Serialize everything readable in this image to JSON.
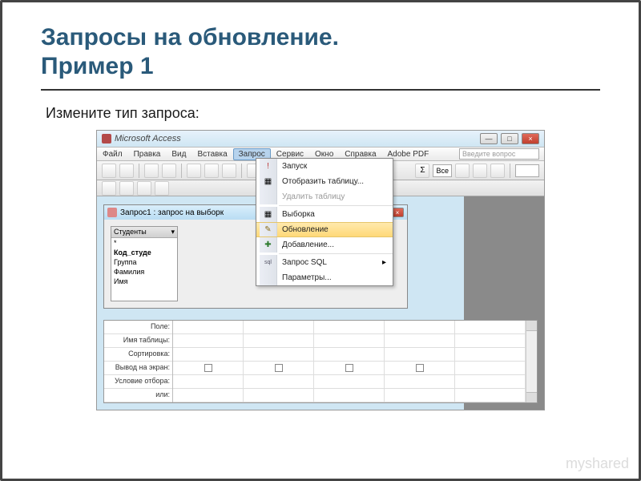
{
  "slide": {
    "title_line1": "Запросы на обновление.",
    "title_line2": "Пример 1",
    "subtitle": "Измените тип запроса:"
  },
  "watermark": "myshared",
  "app": {
    "title": "Microsoft Access",
    "win_min": "—",
    "win_max": "□",
    "win_close": "×"
  },
  "menubar": {
    "file": "Файл",
    "edit": "Правка",
    "view": "Вид",
    "insert": "Вставка",
    "query": "Запрос",
    "tools": "Сервис",
    "window": "Окно",
    "help": "Справка",
    "adobepdf": "Adobe PDF",
    "ask_placeholder": "Введите вопрос"
  },
  "toolbar": {
    "sum": "Σ",
    "all": "Все"
  },
  "mdi": {
    "title": "Запрос1 : запрос на выборк"
  },
  "fieldlist": {
    "header": "Студенты",
    "star": "*",
    "items": [
      "Код_студе",
      "Группа",
      "Фамилия",
      "Имя"
    ]
  },
  "dropdown": {
    "run": "Запуск",
    "show_table": "Отобразить таблицу...",
    "delete_table": "Удалить таблицу",
    "select": "Выборка",
    "update": "Обновление",
    "append": "Добавление...",
    "sql": "Запрос SQL",
    "params": "Параметры..."
  },
  "grid": {
    "row_field": "Поле:",
    "row_table": "Имя таблицы:",
    "row_sort": "Сортировка:",
    "row_show": "Вывод на экран:",
    "row_criteria": "Условие отбора:",
    "row_or": "или:"
  },
  "icons": {
    "run": "!",
    "sql": "sql",
    "pencil": "✎",
    "plus": "✚",
    "chev": "▸"
  }
}
